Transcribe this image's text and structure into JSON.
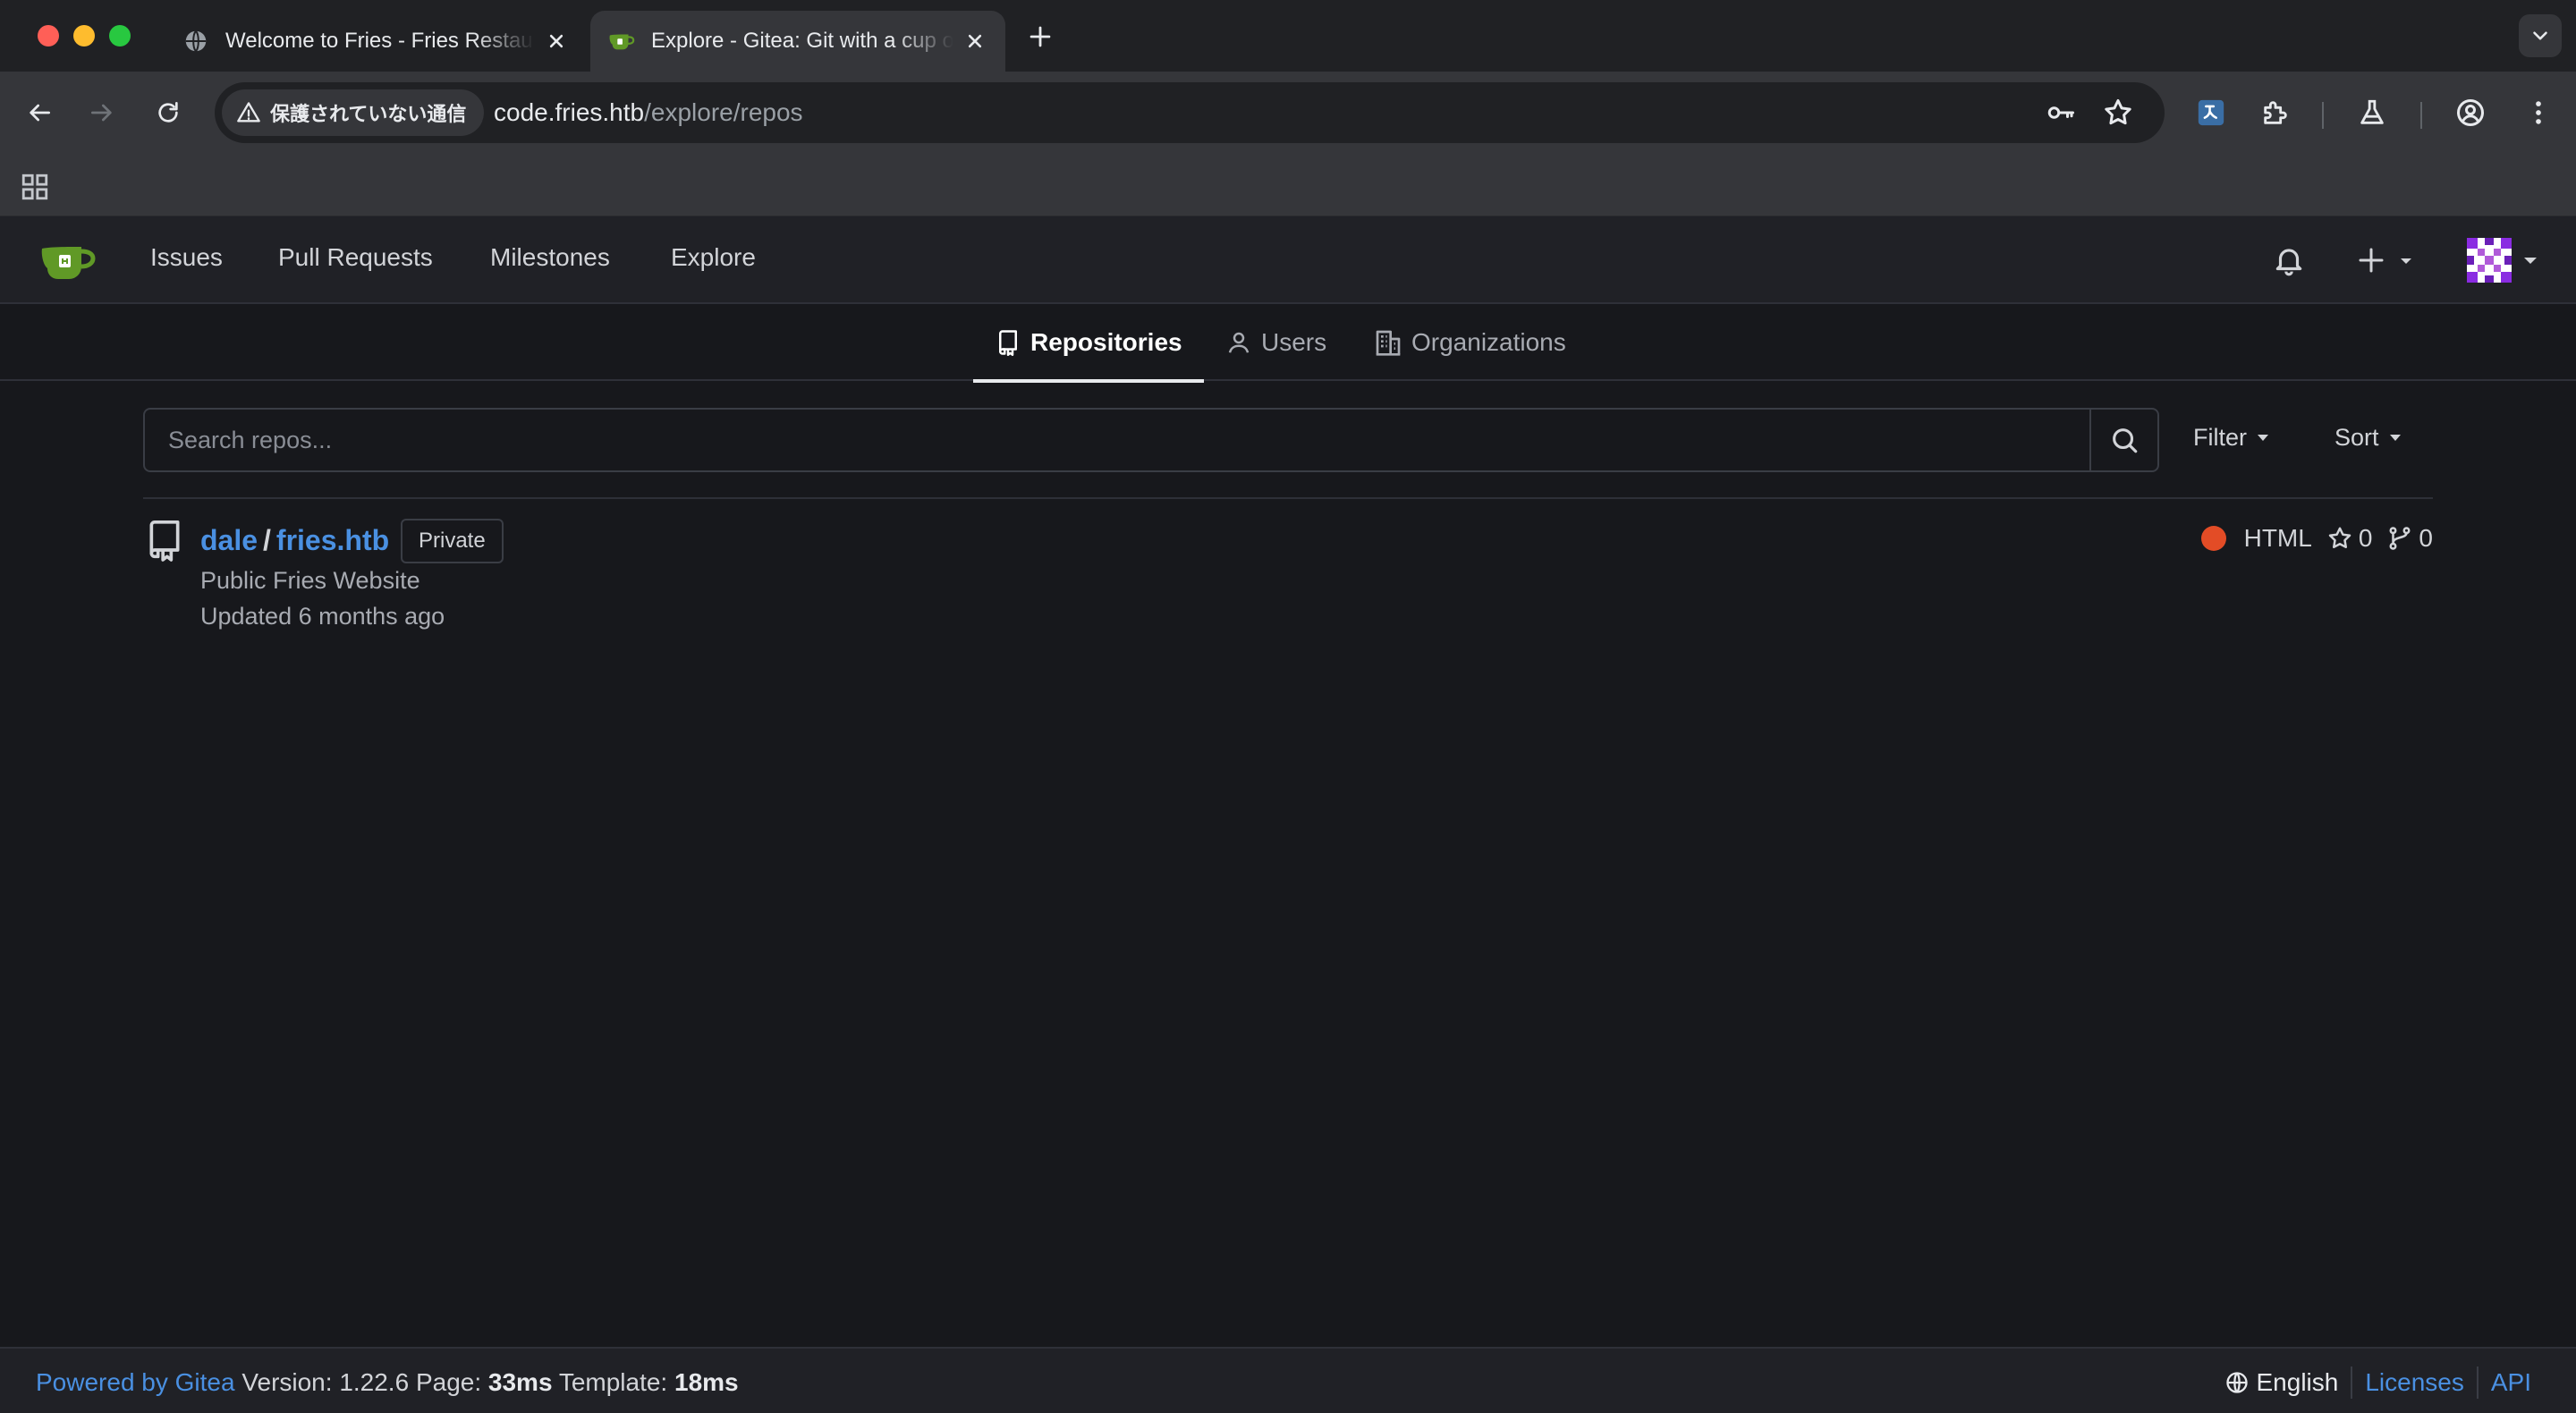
{
  "browser": {
    "tabs": [
      {
        "title": "Welcome to Fries - Fries Restaurant",
        "active": false,
        "favicon": "globe-icon"
      },
      {
        "title": "Explore - Gitea: Git with a cup of tea",
        "active": true,
        "favicon": "gitea-favicon"
      }
    ],
    "security_label": "保護されていない通信",
    "url_host": "code.fries.htb",
    "url_path": "/explore/repos"
  },
  "navbar": {
    "items": [
      "Issues",
      "Pull Requests",
      "Milestones",
      "Explore"
    ]
  },
  "explore_tabs": [
    {
      "label": "Repositories",
      "icon": "repo-icon",
      "active": true
    },
    {
      "label": "Users",
      "icon": "person-icon",
      "active": false
    },
    {
      "label": "Organizations",
      "icon": "organization-icon",
      "active": false
    }
  ],
  "search": {
    "placeholder": "Search repos...",
    "filter_label": "Filter",
    "sort_label": "Sort"
  },
  "repos": [
    {
      "owner": "dale",
      "name": "fries.htb",
      "visibility": "Private",
      "description": "Public Fries Website",
      "updated": "Updated 6 months ago",
      "language": "HTML",
      "language_color": "#e34c26",
      "stars": "0",
      "forks": "0"
    }
  ],
  "footer": {
    "powered_by": "Powered by Gitea",
    "version_label": "Version:",
    "version": "1.22.6",
    "page_label": "Page:",
    "page_time": "33ms",
    "template_label": "Template:",
    "template_time": "18ms",
    "language": "English",
    "licenses": "Licenses",
    "api": "API"
  },
  "colors": {
    "accent_link": "#4a90e2",
    "page_background": "#17181c"
  }
}
